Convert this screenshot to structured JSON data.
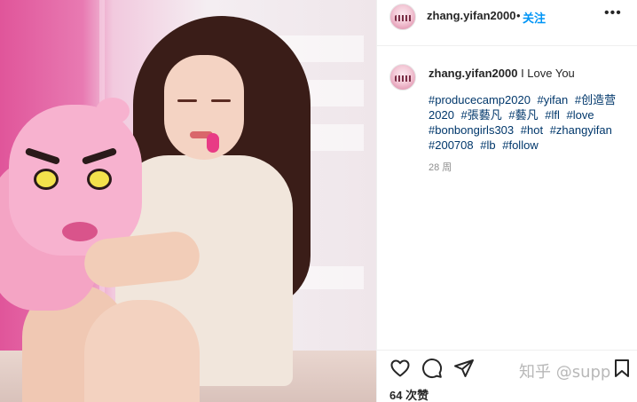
{
  "post": {
    "username": "zhang.yifan2000",
    "separator": "•",
    "follow_label": "关注",
    "more_icon": "•••"
  },
  "caption": {
    "username": "zhang.yifan2000",
    "text": "I Love You",
    "hashtags": [
      "#producecamp2020",
      "#yifan",
      "#创造营2020",
      "#張藝凡",
      "#藝凡",
      "#lfl",
      "#love",
      "#bonbongirls303",
      "#hot",
      "#zhangyifan",
      "#200708",
      "#lb",
      "#follow"
    ],
    "time_ago": "28 周"
  },
  "actions": {
    "icons": [
      "heart-icon",
      "comment-icon",
      "share-icon",
      "bookmark-icon"
    ],
    "likes": "64 次赞"
  },
  "watermark": "知乎 @supp",
  "colors": {
    "follow": "#0095f6",
    "hashtag": "#00376b",
    "muted": "#8e8e8e"
  }
}
